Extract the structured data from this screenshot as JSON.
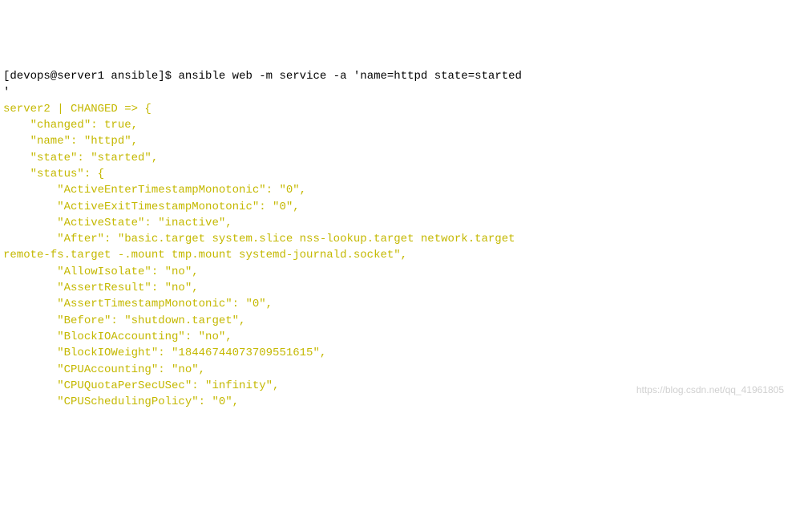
{
  "prompt": {
    "user_host": "[devops@server1 ansible]$",
    "command": "ansible web -m service -a 'name=httpd state=started\n'"
  },
  "output": {
    "header": "server2 | CHANGED => {",
    "lines": [
      "    \"changed\": true,",
      "    \"name\": \"httpd\",",
      "    \"state\": \"started\",",
      "    \"status\": {",
      "        \"ActiveEnterTimestampMonotonic\": \"0\",",
      "        \"ActiveExitTimestampMonotonic\": \"0\",",
      "        \"ActiveState\": \"inactive\",",
      "        \"After\": \"basic.target system.slice nss-lookup.target network.target\nremote-fs.target -.mount tmp.mount systemd-journald.socket\",",
      "        \"AllowIsolate\": \"no\",",
      "        \"AssertResult\": \"no\",",
      "        \"AssertTimestampMonotonic\": \"0\",",
      "        \"Before\": \"shutdown.target\",",
      "        \"BlockIOAccounting\": \"no\",",
      "        \"BlockIOWeight\": \"18446744073709551615\",",
      "        \"CPUAccounting\": \"no\",",
      "        \"CPUQuotaPerSecUSec\": \"infinity\",",
      "        \"CPUSchedulingPolicy\": \"0\","
    ]
  },
  "watermark": "https://blog.csdn.net/qq_41961805"
}
